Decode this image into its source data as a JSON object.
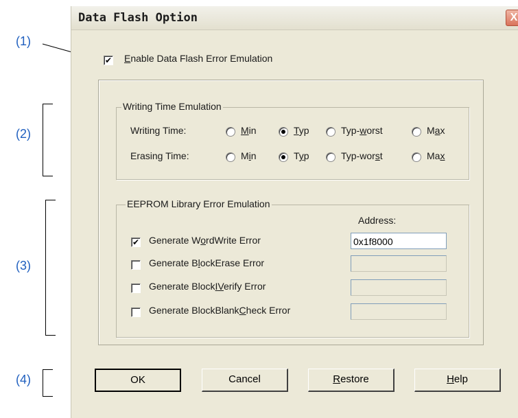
{
  "callouts": [
    "(1)",
    "(2)",
    "(3)",
    "(4)"
  ],
  "dialog": {
    "title": "Data Flash Option",
    "close_glyph": "X",
    "enable": {
      "label": "Enable Data Flash Error Emulation",
      "checked": true
    },
    "writing_group": {
      "title": "Writing Time Emulation",
      "rows": [
        {
          "label": "Writing Time:",
          "options": [
            "Min",
            "Typ",
            "Typ-worst",
            "Max"
          ],
          "selected": "Typ"
        },
        {
          "label": "Erasing Time:",
          "options": [
            "Min",
            "Typ",
            "Typ-worst",
            "Max"
          ],
          "selected": "Typ"
        }
      ]
    },
    "eeprom_group": {
      "title": "EEPROM Library Error Emulation",
      "address_label": "Address:",
      "items": [
        {
          "label": "Generate WordWrite Error",
          "checked": true,
          "address": "0x1f8000"
        },
        {
          "label": "Generate BlockErase Error",
          "checked": false,
          "address": ""
        },
        {
          "label": "Generate BlockIVerify Error",
          "checked": false,
          "address": ""
        },
        {
          "label": "Generate BlockBlankCheck Error",
          "checked": false,
          "address": ""
        }
      ]
    },
    "buttons": {
      "ok": "OK",
      "cancel": "Cancel",
      "restore": "Restore",
      "help": "Help"
    }
  }
}
